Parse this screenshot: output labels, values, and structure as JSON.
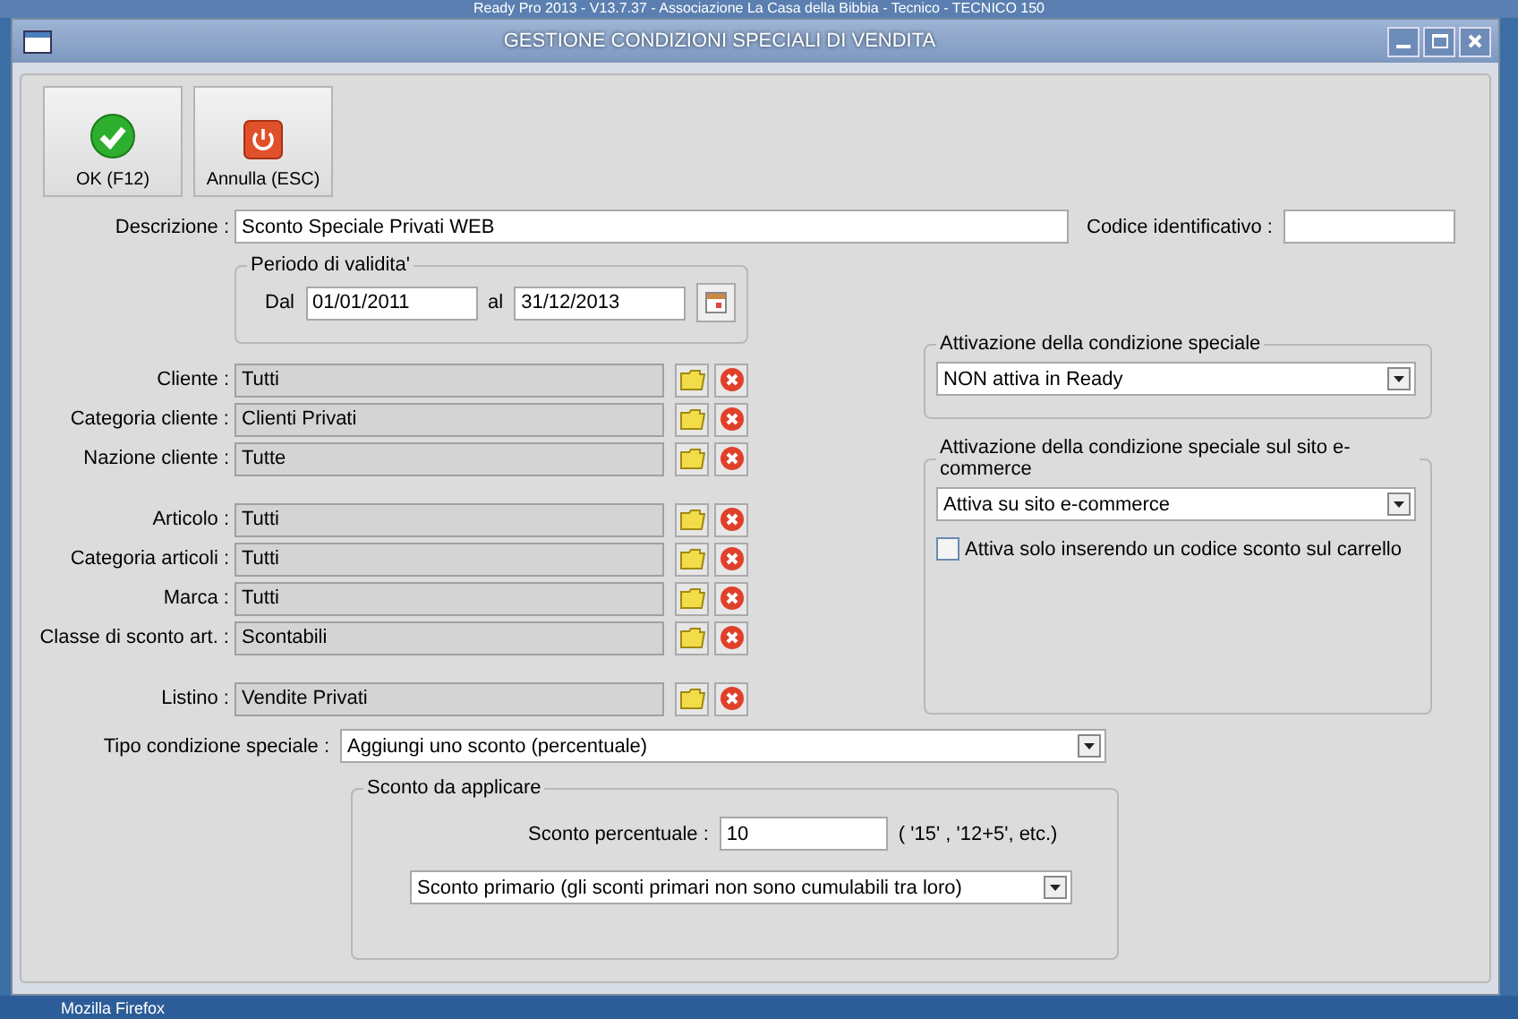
{
  "background_window": {
    "title": "Ready Pro 2013 - V13.7.37 - Associazione La Casa della Bibbia - Tecnico - TECNICO 150"
  },
  "window": {
    "title": "GESTIONE CONDIZIONI SPECIALI DI VENDITA"
  },
  "toolbar": [
    {
      "kind": "ok",
      "label": "OK (F12)"
    },
    {
      "kind": "cancel",
      "label": "Annulla (ESC)"
    }
  ],
  "descrizione": {
    "label": "Descrizione :",
    "value": "Sconto Speciale Privati WEB"
  },
  "codice": {
    "label": "Codice identificativo :"
  },
  "periodo": {
    "title": "Periodo di validita'",
    "from_label": "Dal",
    "from": "01/01/2011",
    "to_label": "al",
    "to": "31/12/2013"
  },
  "lookup_groups": [
    [
      {
        "label": "Cliente :",
        "value": "Tutti"
      },
      {
        "label": "Categoria cliente :",
        "value": "Clienti Privati"
      },
      {
        "label": "Nazione cliente :",
        "value": "Tutte"
      }
    ],
    [
      {
        "label": "Articolo :",
        "value": "Tutti"
      },
      {
        "label": "Categoria articoli :",
        "value": "Tutti"
      },
      {
        "label": "Marca :",
        "value": "Tutti"
      },
      {
        "label": "Classe di sconto art. :",
        "value": "Scontabili"
      }
    ],
    [
      {
        "label": "Listino :",
        "value": "Vendite Privati"
      }
    ]
  ],
  "attivazione": {
    "title": "Attivazione della condizione speciale",
    "value": "NON attiva in Ready"
  },
  "attivazione_web": {
    "title": "Attivazione della condizione speciale sul sito e-commerce",
    "value": "Attiva su sito e-commerce",
    "checkbox": {
      "label": "Attiva solo inserendo un codice sconto sul carrello",
      "checked": false
    }
  },
  "tipo": {
    "label": "Tipo condizione speciale :",
    "value": "Aggiungi uno sconto (percentuale)"
  },
  "sconto": {
    "title": "Sconto da applicare",
    "label": "Sconto percentuale :",
    "value": "10",
    "hint": "( '15' ,  '12+5', etc.)",
    "type_value": "Sconto primario (gli sconti primari non sono cumulabili tra loro)"
  },
  "taskbar": {
    "items": [
      "Mozilla Firefox"
    ]
  }
}
